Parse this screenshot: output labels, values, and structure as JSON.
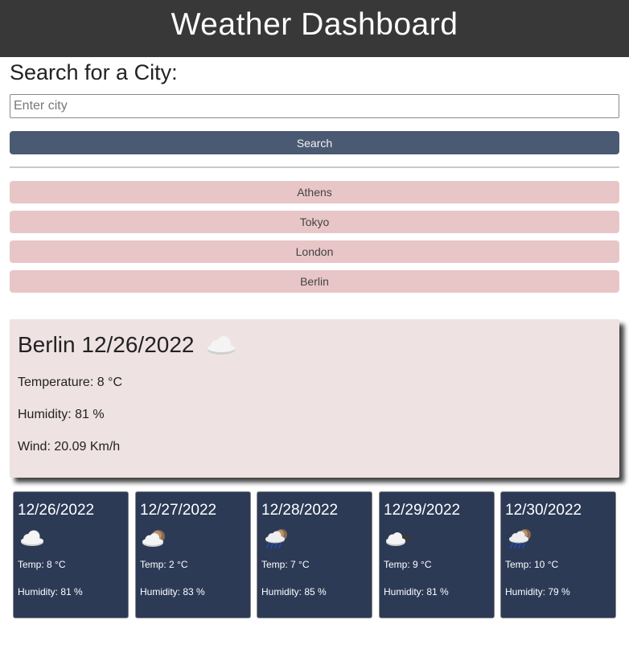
{
  "header": {
    "title": "Weather Dashboard"
  },
  "search": {
    "heading": "Search for a City:",
    "placeholder": "Enter city",
    "value": "",
    "button_label": "Search"
  },
  "history": [
    {
      "label": "Athens"
    },
    {
      "label": "Tokyo"
    },
    {
      "label": "London"
    },
    {
      "label": "Berlin"
    }
  ],
  "current": {
    "title": "Berlin 12/26/2022",
    "icon": "cloud-icon",
    "temperature": "Temperature: 8 °C",
    "humidity": "Humidity: 81 %",
    "wind": "Wind: 20.09 Km/h"
  },
  "forecast": [
    {
      "date": "12/26/2022",
      "icon": "cloud-icon",
      "temp": "Temp: 8 °C",
      "humidity": "Humidity: 81 %"
    },
    {
      "date": "12/27/2022",
      "icon": "partly-cloudy-icon",
      "temp": "Temp: 2 °C",
      "humidity": "Humidity: 83 %"
    },
    {
      "date": "12/28/2022",
      "icon": "rain-icon",
      "temp": "Temp: 7 °C",
      "humidity": "Humidity: 85 %"
    },
    {
      "date": "12/29/2022",
      "icon": "cloud-night-icon",
      "temp": "Temp: 9 °C",
      "humidity": "Humidity: 81 %"
    },
    {
      "date": "12/30/2022",
      "icon": "rain-icon",
      "temp": "Temp: 10 °C",
      "humidity": "Humidity: 79 %"
    }
  ],
  "colors": {
    "header_bg": "#383838",
    "search_button": "#4b5a73",
    "history_button": "#e8c6c7",
    "current_bg": "#eee2e3",
    "forecast_bg": "#2c3a56"
  }
}
